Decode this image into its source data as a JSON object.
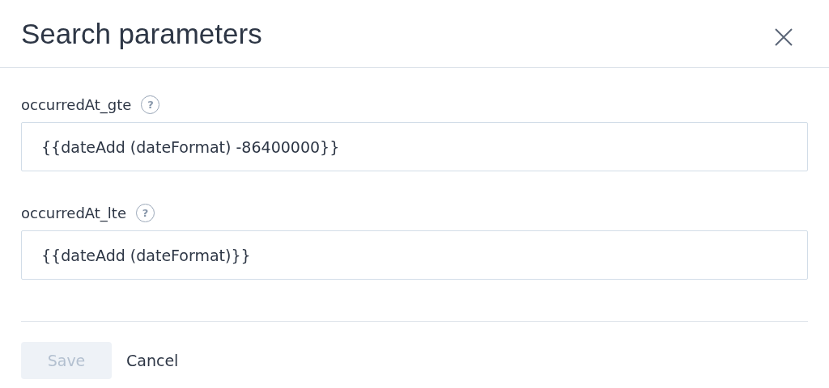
{
  "dialog": {
    "title": "Search parameters"
  },
  "fields": [
    {
      "label": "occurredAt_gte",
      "help": "?",
      "value": "{{dateAdd (dateFormat) -86400000}}"
    },
    {
      "label": "occurredAt_lte",
      "help": "?",
      "value": "{{dateAdd (dateFormat)}}"
    }
  ],
  "buttons": [
    {
      "label": "Save",
      "kind": "primary",
      "disabled": true
    },
    {
      "label": "Cancel",
      "kind": "link",
      "disabled": false
    }
  ]
}
